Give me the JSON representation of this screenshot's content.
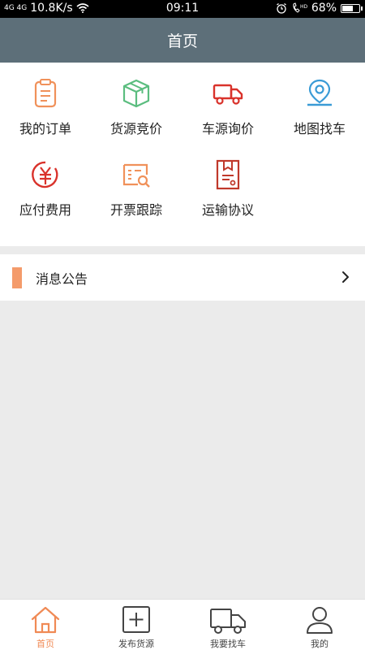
{
  "status_bar": {
    "signal": "4G 4G",
    "speed": "10.8K/s",
    "time": "09:11",
    "battery_percent": "68%",
    "battery_level": 0.68
  },
  "header": {
    "title": "首页"
  },
  "menu": {
    "items": [
      {
        "label": "我的订单",
        "icon": "clipboard-icon",
        "color": "#f0915a"
      },
      {
        "label": "货源竞价",
        "icon": "package-box-icon",
        "color": "#5bbd7f"
      },
      {
        "label": "车源询价",
        "icon": "truck-icon",
        "color": "#d9322b"
      },
      {
        "label": "地图找车",
        "icon": "map-pin-icon",
        "color": "#3a9bd6"
      },
      {
        "label": "应付费用",
        "icon": "yuan-coin-icon",
        "color": "#d9322b"
      },
      {
        "label": "开票跟踪",
        "icon": "invoice-search-icon",
        "color": "#f0915a"
      },
      {
        "label": "运输协议",
        "icon": "contract-document-icon",
        "color": "#c0392b"
      }
    ]
  },
  "notice": {
    "label": "消息公告",
    "accent": "#f49b6b"
  },
  "tab_bar": {
    "active_color": "#f08a55",
    "items": [
      {
        "label": "首页",
        "icon": "home-icon",
        "active": true
      },
      {
        "label": "发布货源",
        "icon": "add-square-icon",
        "active": false
      },
      {
        "label": "我要找车",
        "icon": "truck-icon",
        "active": false
      },
      {
        "label": "我的",
        "icon": "user-icon",
        "active": false
      }
    ]
  }
}
